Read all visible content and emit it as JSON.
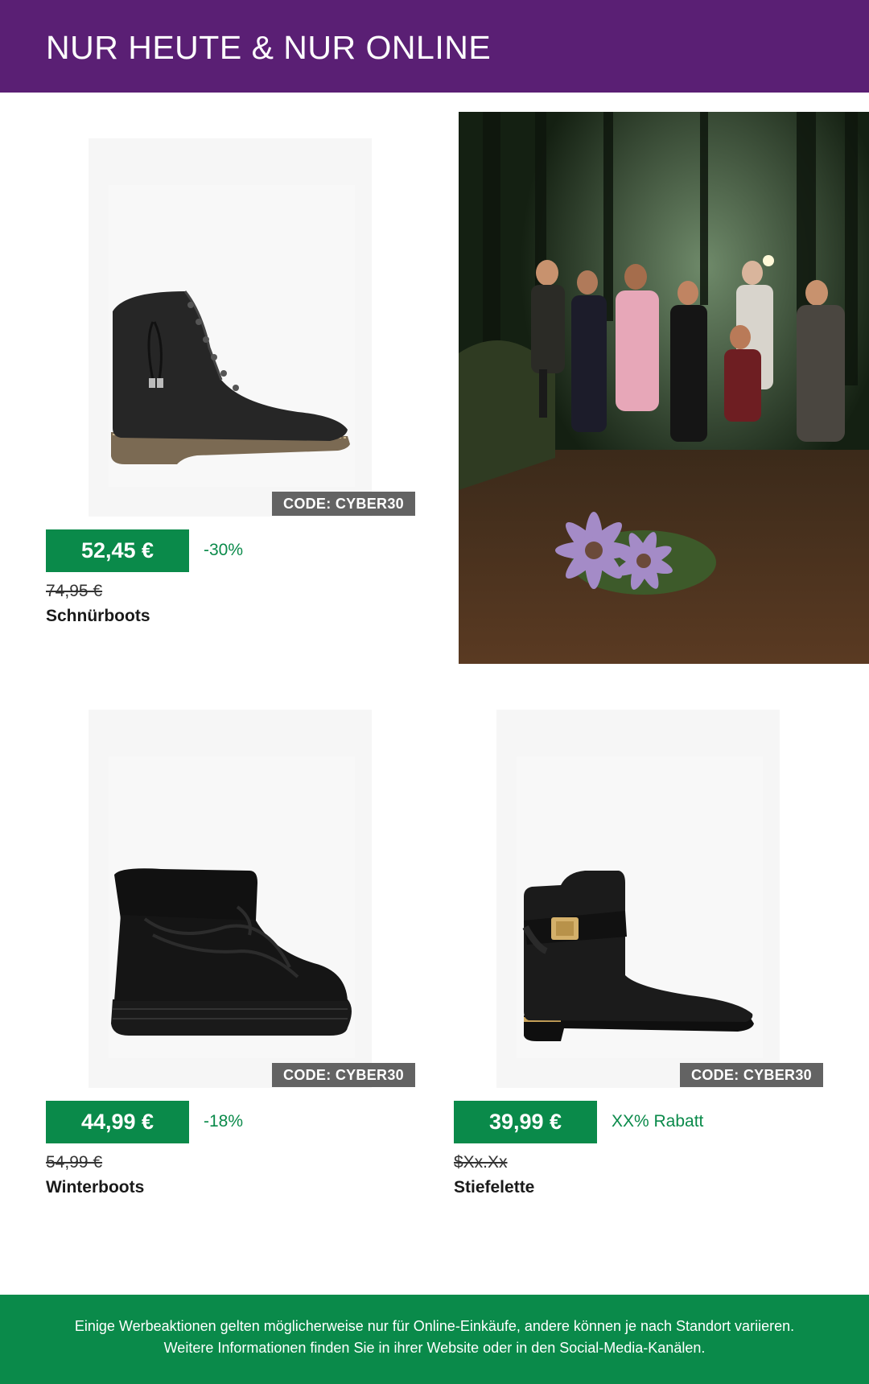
{
  "header": {
    "title": "NUR HEUTE & NUR ONLINE",
    "background": "#5a1f74"
  },
  "accent_green": "#0a8a4a",
  "products": [
    {
      "name": "Schnürboots",
      "price": "52,45 €",
      "discount": "-30%",
      "old_price": "74,95 €",
      "code": "CODE: CYBER30",
      "image": "black-lace-up-ankle-boot"
    },
    {
      "name": "Winterboots",
      "price": "44,99 €",
      "discount": "-18%",
      "old_price": "54,99 €",
      "code": "CODE: CYBER30",
      "image": "black-platform-winter-boot"
    },
    {
      "name": "Stiefelette",
      "price": "39,99 €",
      "discount": "XX% Rabatt",
      "old_price": "$Xx.Xx",
      "code": "CODE: CYBER30",
      "image": "black-leather-ankle-boot-with-gold-buckle"
    }
  ],
  "hero_image": "group-portrait-in-forest-with-purple-flowers",
  "footer": {
    "text": "Einige Werbeaktionen gelten möglicherweise nur für Online-Einkäufe, andere können je nach Standort variieren. Weitere Informationen finden Sie in ihrer Website oder in den Social-Media-Kanälen."
  }
}
